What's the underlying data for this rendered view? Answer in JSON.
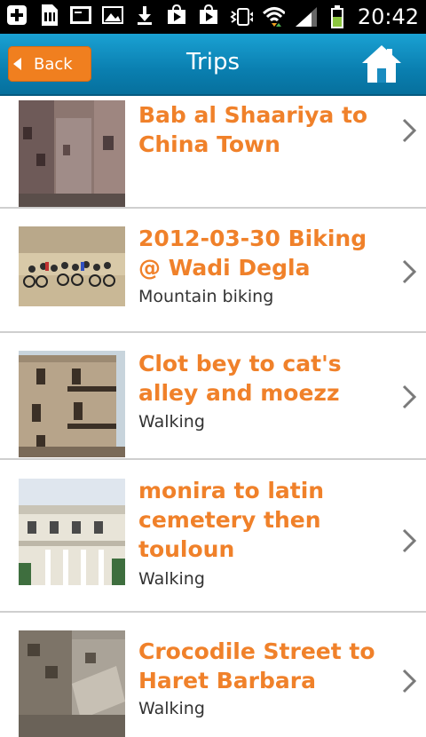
{
  "status_bar": {
    "time": "20:42",
    "icons": [
      "add-icon",
      "sd-card-icon",
      "screenshot-icon",
      "image-icon",
      "download-icon",
      "play-store-icon",
      "play-store-icon",
      "vibrate-icon",
      "wifi-icon",
      "signal-icon",
      "battery-icon"
    ]
  },
  "header": {
    "back_label": "Back",
    "title": "Trips",
    "home_icon": "home-icon",
    "accent": "#f07f1f",
    "bar_color": "#0a7fb0"
  },
  "trips": [
    {
      "title": "Bab al Shaariya to China Town",
      "subtitle": ""
    },
    {
      "title": "2012-03-30 Biking @ Wadi Degla",
      "subtitle": "Mountain biking"
    },
    {
      "title": "Clot bey to cat's alley and moezz",
      "subtitle": "Walking"
    },
    {
      "title": "monira to latin cemetery then touloun",
      "subtitle": "Walking"
    },
    {
      "title": "Crocodile Street to Haret Barbara",
      "subtitle": "Walking"
    }
  ],
  "colors": {
    "title_text": "#f0812a",
    "divider": "#cfcfcf"
  }
}
